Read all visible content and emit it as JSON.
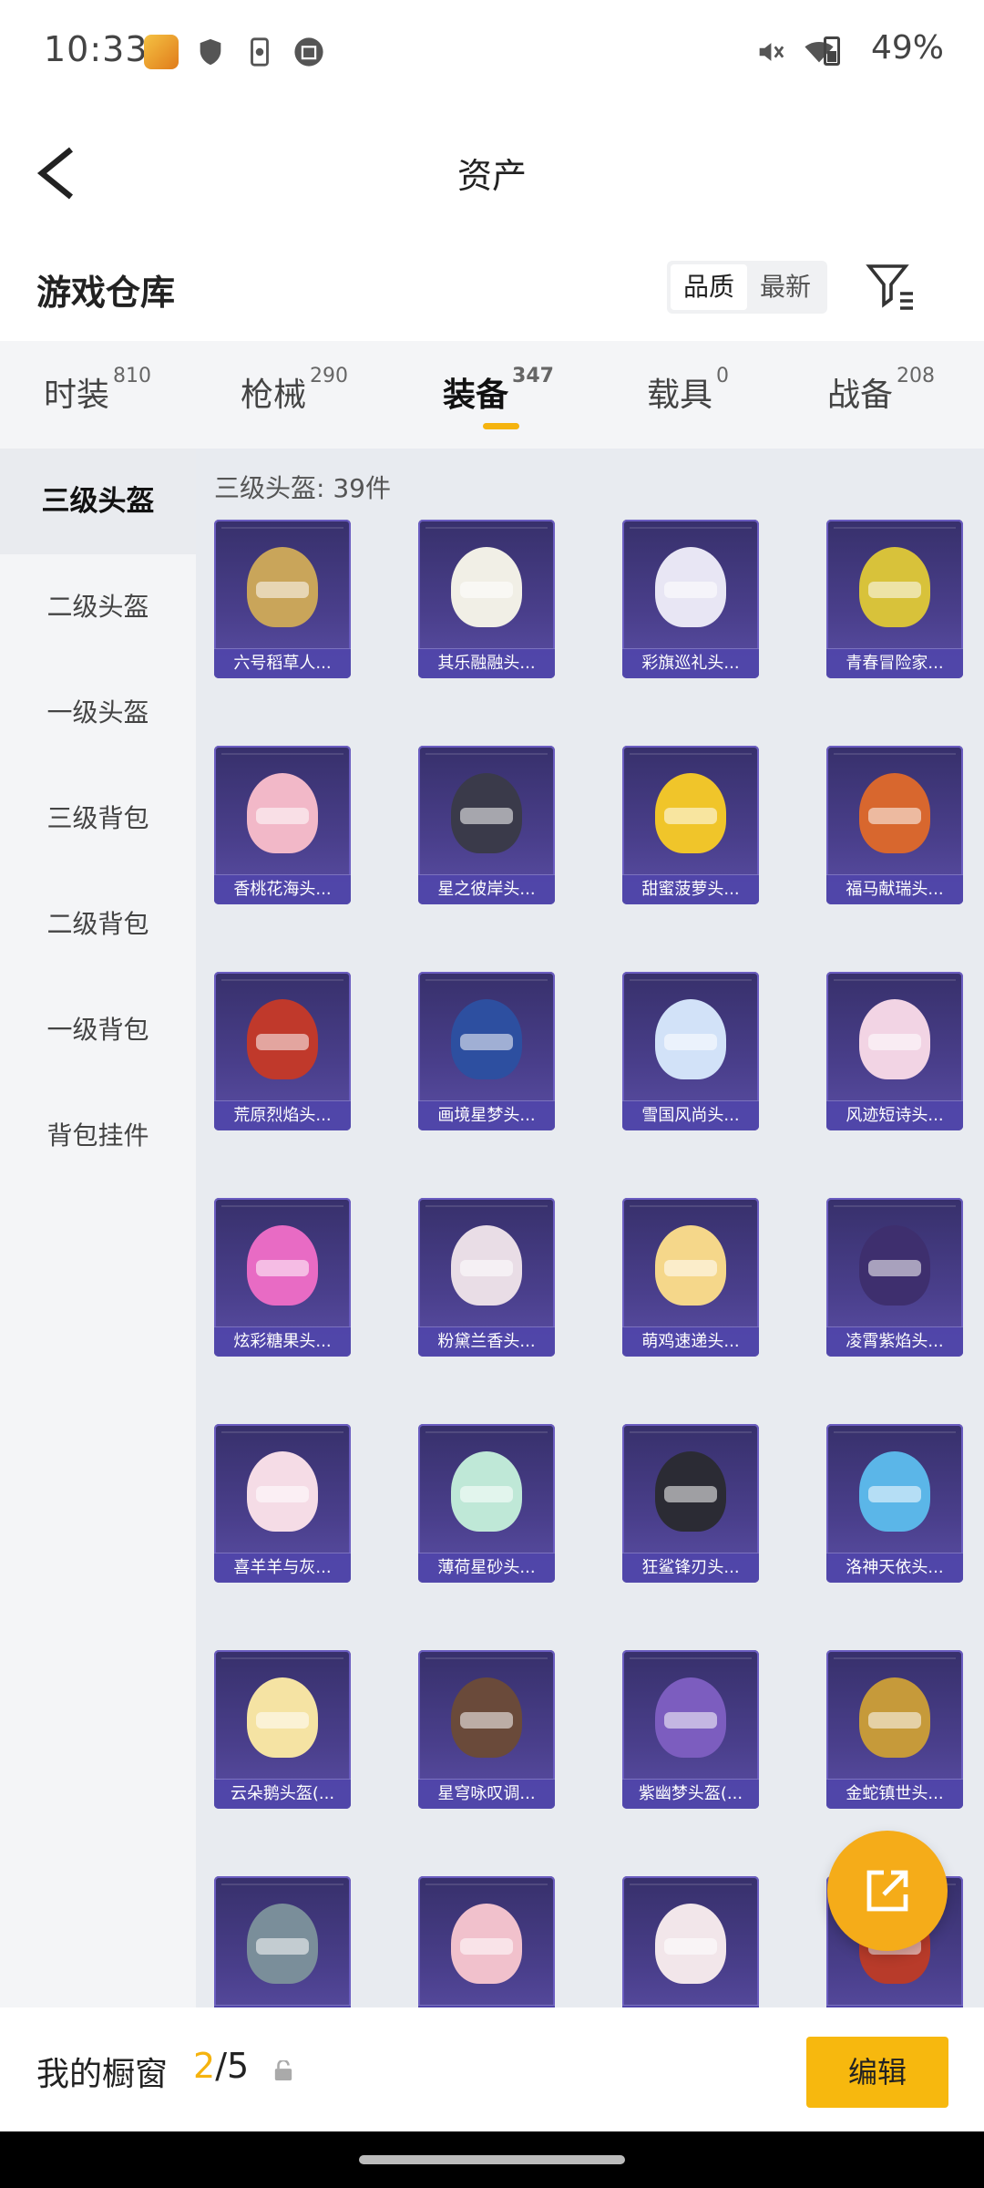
{
  "status_bar": {
    "time": "10:33",
    "battery": "49%"
  },
  "header": {
    "title": "资产"
  },
  "warehouse": {
    "title": "游戏仓库",
    "sort_options": [
      "品质",
      "最新"
    ]
  },
  "tabs": [
    {
      "label": "时装",
      "count": "810"
    },
    {
      "label": "枪械",
      "count": "290"
    },
    {
      "label": "装备",
      "count": "347"
    },
    {
      "label": "载具",
      "count": "0"
    },
    {
      "label": "战备",
      "count": "208"
    }
  ],
  "sidebar": {
    "items": [
      "三级头盔",
      "二级头盔",
      "一级头盔",
      "三级背包",
      "二级背包",
      "一级背包",
      "背包挂件"
    ]
  },
  "content": {
    "category_label": "三级头盔: 39件"
  },
  "items": [
    {
      "name": "六号稻草人...",
      "color": "#c9a55a"
    },
    {
      "name": "其乐融融头...",
      "color": "#f1efe6"
    },
    {
      "name": "彩旗巡礼头...",
      "color": "#e8e6f4"
    },
    {
      "name": "青春冒险家...",
      "color": "#d8c23a"
    },
    {
      "name": "香桃花海头...",
      "color": "#f2b8c8"
    },
    {
      "name": "星之彼岸头...",
      "color": "#3a3a4a"
    },
    {
      "name": "甜蜜菠萝头...",
      "color": "#f0c52a"
    },
    {
      "name": "福马献瑞头...",
      "color": "#d8672e"
    },
    {
      "name": "荒原烈焰头...",
      "color": "#c0392b"
    },
    {
      "name": "画境星梦头...",
      "color": "#2d4fa0"
    },
    {
      "name": "雪国风尚头...",
      "color": "#d2e2f8"
    },
    {
      "name": "风迹短诗头...",
      "color": "#f2d4e4"
    },
    {
      "name": "炫彩糖果头...",
      "color": "#e86bc4"
    },
    {
      "name": "粉黛兰香头...",
      "color": "#e9dde6"
    },
    {
      "name": "萌鸡速递头...",
      "color": "#f5d78a"
    },
    {
      "name": "凌霄紫焰头...",
      "color": "#3e2f6e"
    },
    {
      "name": "喜羊羊与灰...",
      "color": "#f5dce6"
    },
    {
      "name": "薄荷星砂头...",
      "color": "#bfe8d7"
    },
    {
      "name": "狂鲨锋刃头...",
      "color": "#2b2b34"
    },
    {
      "name": "洛神天依头...",
      "color": "#5bb6e8"
    },
    {
      "name": "云朵鹅头盔(...",
      "color": "#f5e3a3"
    },
    {
      "name": "星穹咏叹调...",
      "color": "#6a4a3a"
    },
    {
      "name": "紫幽梦头盔(...",
      "color": "#7c5dbf"
    },
    {
      "name": "金蛇镇世头...",
      "color": "#c69a3a"
    },
    {
      "name": "",
      "color": "#7a8e9a"
    },
    {
      "name": "",
      "color": "#f1c1cc"
    },
    {
      "name": "",
      "color": "#f2e6ea"
    },
    {
      "name": "",
      "color": "#b83b2a"
    }
  ],
  "bottom_bar": {
    "label": "我的橱窗",
    "current": "2",
    "separator": "/",
    "max": "5",
    "edit_label": "编辑"
  }
}
